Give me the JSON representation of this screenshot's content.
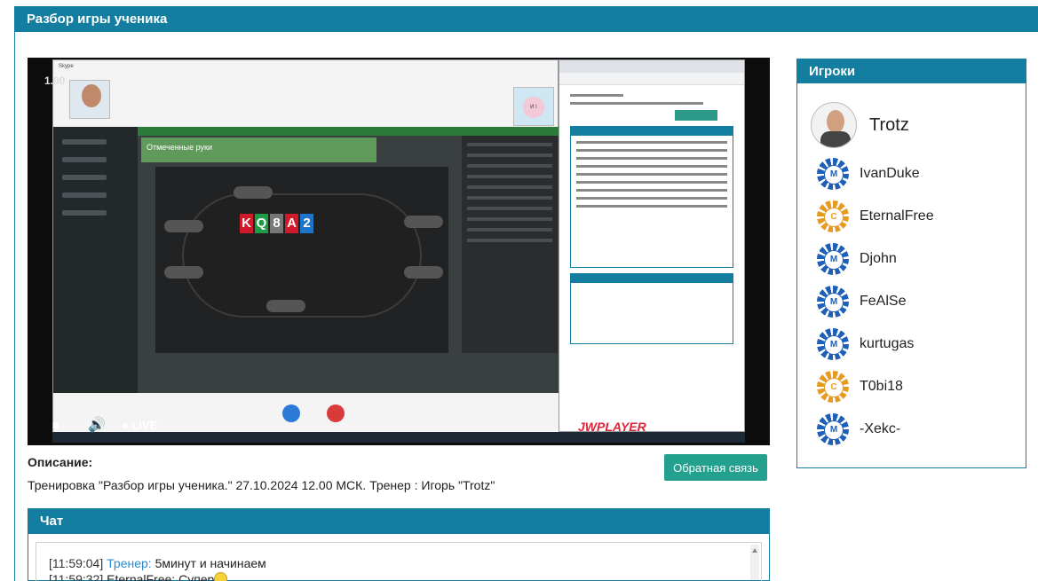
{
  "header": {
    "title": "Разбор игры ученика"
  },
  "player": {
    "speed": "1.00",
    "live_label": "LIVE",
    "brand": "JWPLAYER",
    "board_cards": [
      {
        "rank": "K",
        "color": "#d01a2a"
      },
      {
        "rank": "Q",
        "color": "#1f9a45"
      },
      {
        "rank": "8",
        "color": "#777777"
      },
      {
        "rank": "A",
        "color": "#d01a2a"
      },
      {
        "rank": "2",
        "color": "#1e74c9"
      }
    ],
    "shared_panel_title": "Отмеченные руки",
    "skype_title": "Skype"
  },
  "description": {
    "title": "Описание:",
    "text": "Тренировка \"Разбор игры ученика.\" 27.10.2024 12.00 МСК. Тренер : Игорь \"Trotz\"",
    "feedback_button": "Обратная связь"
  },
  "chat": {
    "title": "Чат",
    "messages": [
      {
        "time": "[11:59:04]",
        "author": "Тренер:",
        "text": "5минут и начинаем"
      },
      {
        "time": "[11:59:32]",
        "author": "EternalFree:",
        "text": "Супер"
      }
    ]
  },
  "players": {
    "title": "Игроки",
    "host": "Trotz",
    "list": [
      {
        "name": "IvanDuke",
        "chip": "M"
      },
      {
        "name": "EternalFree",
        "chip": "C"
      },
      {
        "name": "Djohn",
        "chip": "M"
      },
      {
        "name": "FeAlSe",
        "chip": "M"
      },
      {
        "name": "kurtugas",
        "chip": "M"
      },
      {
        "name": "T0bi18",
        "chip": "C"
      },
      {
        "name": "-Xekc-",
        "chip": "M"
      }
    ]
  },
  "colors": {
    "accent": "#137e9f",
    "button": "#24a08f",
    "tutor": "#2a8bd0"
  }
}
